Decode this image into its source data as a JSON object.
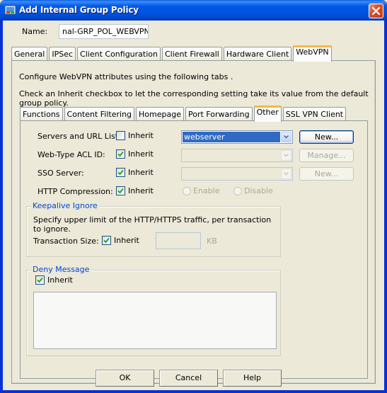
{
  "window": {
    "title": "Add Internal Group Policy",
    "icon": "app-icon",
    "close_icon": "close-icon"
  },
  "name_field": {
    "label": "Name:",
    "value": "nal-GRP_POL_WEBVPN"
  },
  "outer_tabs": [
    {
      "label": "General",
      "active": false
    },
    {
      "label": "IPSec",
      "active": false
    },
    {
      "label": "Client Configuration",
      "active": false
    },
    {
      "label": "Client Firewall",
      "active": false
    },
    {
      "label": "Hardware Client",
      "active": false
    },
    {
      "label": "WebVPN",
      "active": true
    }
  ],
  "webvpn": {
    "description_1": "Configure WebVPN attributes using the following tabs .",
    "description_2": "Check an Inherit checkbox to let the corresponding setting take its value from the default group policy.",
    "inner_tabs": [
      {
        "label": "Functions",
        "active": false
      },
      {
        "label": "Content Filtering",
        "active": false
      },
      {
        "label": "Homepage",
        "active": false
      },
      {
        "label": "Port Forwarding",
        "active": false
      },
      {
        "label": "Other",
        "active": true
      },
      {
        "label": "SSL VPN Client",
        "active": false
      }
    ],
    "other": {
      "servers_url_lists": {
        "label": "Servers and URL Lists:",
        "inherit_label": "Inherit",
        "inherit_checked": false,
        "selected": "webserver",
        "button": "New..."
      },
      "web_type_acl": {
        "label": "Web-Type ACL ID:",
        "inherit_label": "Inherit",
        "inherit_checked": true,
        "selected": "",
        "button": "Manage..."
      },
      "sso_server": {
        "label": "SSO Server:",
        "inherit_label": "Inherit",
        "inherit_checked": true,
        "selected": "",
        "button": "New..."
      },
      "http_compression": {
        "label": "HTTP Compression:",
        "inherit_label": "Inherit",
        "inherit_checked": true,
        "enable_label": "Enable",
        "disable_label": "Disable"
      },
      "keepalive_ignore": {
        "title": "Keepalive Ignore",
        "description": "Specify upper limit of the HTTP/HTTPS traffic, per transaction to ignore.",
        "transaction_size_label": "Transaction Size:",
        "inherit_label": "Inherit",
        "inherit_checked": true,
        "value": "",
        "unit": "KB"
      },
      "deny_message": {
        "title": "Deny Message",
        "inherit_label": "Inherit",
        "inherit_checked": true,
        "value": ""
      }
    }
  },
  "footer": {
    "ok": "OK",
    "cancel": "Cancel",
    "help": "Help"
  },
  "colors": {
    "titlebar": "#0054e3",
    "dialog_bg": "#ece9d8",
    "active_tab_accent": "#f7b84a",
    "groupbox_title": "#0046d5",
    "selection": "#316ac5",
    "check": "#21a121"
  }
}
